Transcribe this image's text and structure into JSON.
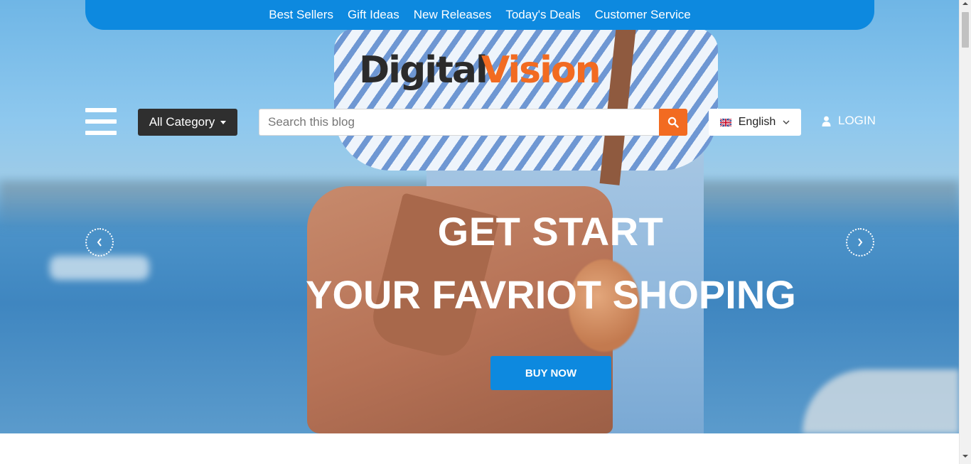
{
  "top_nav": {
    "items": [
      "Best Sellers",
      "Gift Ideas",
      "New Releases",
      "Today's Deals",
      "Customer Service"
    ]
  },
  "logo": {
    "text_dark": "Digital",
    "text_accent": "Vision",
    "dark_color": "#2b2b2b",
    "accent_color": "#f26b21"
  },
  "header": {
    "menu_icon": "hamburger-menu-icon",
    "category_label": "All Category",
    "search_placeholder": "Search this blog",
    "search_value": "",
    "search_icon": "search-icon",
    "language": "English",
    "language_flag": "uk-flag-icon",
    "login_label": "LOGIN",
    "login_icon": "user-icon"
  },
  "hero": {
    "title_line1": "GET START",
    "title_line2": "YOUR FAVRIOT SHOPING",
    "cta_label": "BUY NOW",
    "prev_icon": "chevron-left-icon",
    "next_icon": "chevron-right-icon"
  },
  "colors": {
    "primary_blue": "#0d89df",
    "accent_orange": "#f26b21",
    "dark": "#2f2f2f"
  }
}
